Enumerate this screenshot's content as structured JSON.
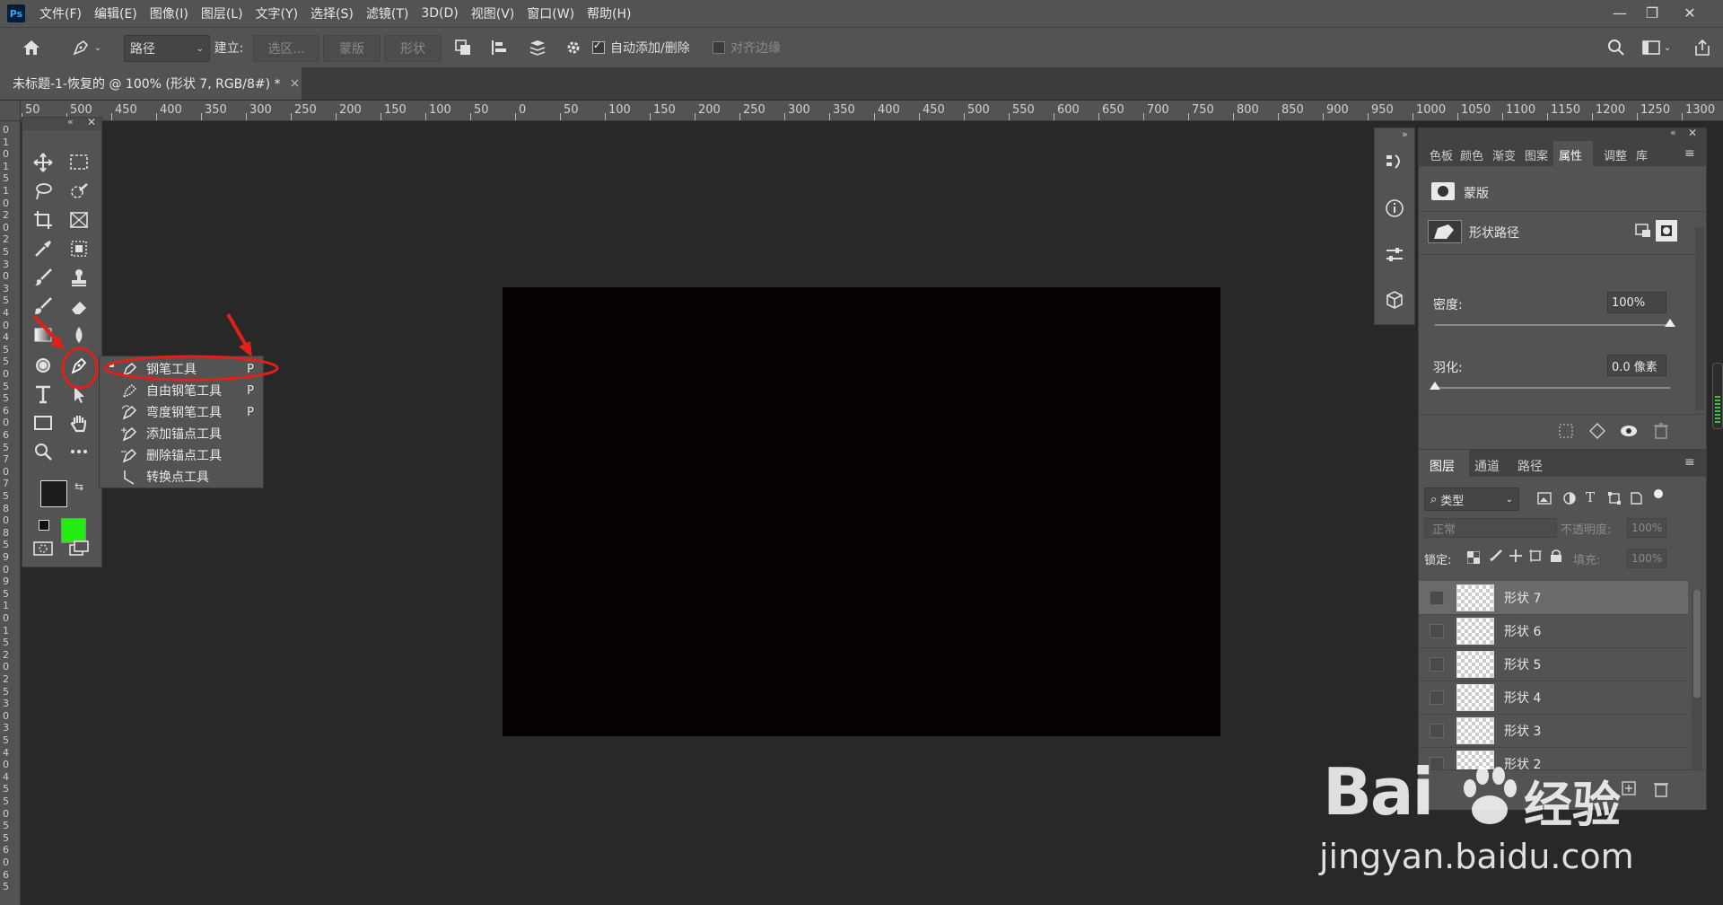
{
  "app": {
    "logo": "Ps"
  },
  "menu": [
    "文件(F)",
    "编辑(E)",
    "图像(I)",
    "图层(L)",
    "文字(Y)",
    "选择(S)",
    "滤镜(T)",
    "3D(D)",
    "视图(V)",
    "窗口(W)",
    "帮助(H)"
  ],
  "window_controls": [
    "minimize-icon",
    "restore-icon",
    "close-icon"
  ],
  "options": {
    "mode_value": "路径",
    "build_label": "建立:",
    "selection_btn": "选区...",
    "mask_btn": "蒙版",
    "shape_btn": "形状",
    "auto_add_delete": "自动添加/删除",
    "auto_add_delete_checked": true,
    "align_edges": "对齐边缘",
    "align_edges_checked": false
  },
  "document": {
    "tab_title": "未标题-1-恢复的 @ 100% (形状 7, RGB/8#) *",
    "close": "×"
  },
  "ruler": {
    "h_labels": [
      "50",
      "500",
      "450",
      "400",
      "350",
      "300",
      "250",
      "200",
      "150",
      "100",
      "50",
      "0",
      "50",
      "100",
      "150",
      "200",
      "250",
      "300",
      "350",
      "400",
      "450",
      "500",
      "550",
      "600",
      "650",
      "700",
      "750",
      "800",
      "850",
      "900",
      "950",
      "1000",
      "1050",
      "1100",
      "1150",
      "1200",
      "1250",
      "1300"
    ],
    "v_labels": [
      "0",
      "1",
      "0",
      "1",
      "5",
      "1",
      "0",
      "2",
      "0",
      "2",
      "5",
      "3",
      "0",
      "3",
      "5",
      "4",
      "0",
      "4",
      "5",
      "5",
      "0",
      "5",
      "5",
      "6",
      "0",
      "6",
      "5",
      "7",
      "0",
      "7",
      "5",
      "8",
      "0",
      "8",
      "5",
      "9",
      "0",
      "9",
      "5",
      "1",
      "0",
      "1",
      "5",
      "2",
      "0",
      "2",
      "5",
      "3",
      "0",
      "3",
      "5",
      "4",
      "0",
      "4",
      "5",
      "5",
      "0",
      "5",
      "5",
      "6",
      "0",
      "6",
      "5"
    ]
  },
  "tool_flyout": {
    "items": [
      {
        "label": "钢笔工具",
        "key": "P"
      },
      {
        "label": "自由钢笔工具",
        "key": "P"
      },
      {
        "label": "弯度钢笔工具",
        "key": "P"
      },
      {
        "label": "添加锚点工具",
        "key": ""
      },
      {
        "label": "删除锚点工具",
        "key": ""
      },
      {
        "label": "转换点工具",
        "key": ""
      }
    ]
  },
  "colors": {
    "foreground": "#1c1c1c",
    "background": "#22ee11",
    "canvas": "#060101",
    "annotation": "#e0201a"
  },
  "properties": {
    "tabs": [
      "色板",
      "颜色",
      "渐变",
      "图案",
      "属性",
      "调整",
      "库"
    ],
    "active_tab": "属性",
    "mask_label": "蒙版",
    "shape_path_label": "形状路径",
    "density_label": "密度:",
    "density_value": "100%",
    "density_level": 1.0,
    "feather_label": "羽化:",
    "feather_value": "0.0 像素",
    "feather_level": 0.0
  },
  "layers": {
    "tabs": [
      "图层",
      "通道",
      "路径"
    ],
    "active_tab": "图层",
    "filter_label": "类型",
    "blend_mode": "正常",
    "opacity_label": "不透明度:",
    "opacity_value": "100%",
    "lock_label": "锁定:",
    "fill_label": "填充:",
    "fill_value": "100%",
    "items": [
      "形状 7",
      "形状 6",
      "形状 5",
      "形状 4",
      "形状 3",
      "形状 2"
    ],
    "selected": "形状 7"
  },
  "watermark": {
    "brand": "Bai",
    "brand2": "经验",
    "url": "jingyan.baidu.com"
  }
}
